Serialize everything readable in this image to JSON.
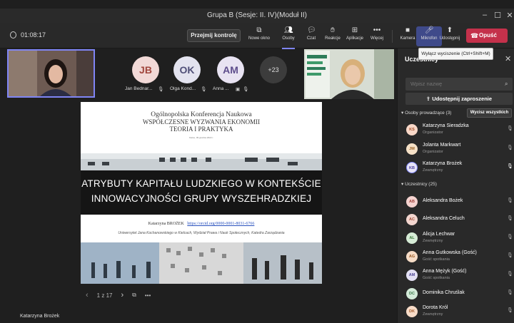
{
  "window": {
    "title": "Grupa B (Sesje: II. IV)(Moduł II)"
  },
  "toolbar": {
    "timer": "01:08:17",
    "take_control": "Przejmij kontrolę",
    "buttons": [
      {
        "label": "Nowe okno",
        "icon": "new-window-icon"
      },
      {
        "label": "Osoby",
        "icon": "people-icon"
      },
      {
        "label": "Czat",
        "icon": "chat-icon"
      },
      {
        "label": "Reakcje",
        "icon": "reactions-icon"
      },
      {
        "label": "Aplikacje",
        "icon": "apps-icon"
      },
      {
        "label": "Więcej",
        "icon": "more-icon"
      },
      {
        "label": "Kamera",
        "icon": "camera-icon"
      },
      {
        "label": "Mikrofon",
        "icon": "microphone-off-icon"
      },
      {
        "label": "Udostępnij",
        "icon": "share-icon"
      }
    ],
    "leave": "Opuść"
  },
  "tooltip": "Wyłącz wyciszenie (Ctrl+Shift+M)",
  "video_strip": {
    "participants": [
      {
        "initials": "JB",
        "name": "Jan Bednar...",
        "color": "#f2d9d7",
        "text_color": "#a1463d"
      },
      {
        "initials": "OK",
        "name": "Olga Kond...",
        "color": "#e3e3ef",
        "text_color": "#505078"
      },
      {
        "initials": "AM",
        "name": "Anna ...",
        "color": "#e8e3f2",
        "text_color": "#5e4e8c"
      }
    ],
    "overflow": "+23"
  },
  "slide": {
    "conf_line1": "Ogólnopolska Konferencja Naukowa",
    "conf_line2": "WSPÓŁCZESNE WYZWANIA EKONOMII",
    "conf_line3": "TEORIA I PRAKTYKA",
    "date": "Kielce, 09 grudnia 2022 r.",
    "title_line1": "ATRYBUTY KAPITAŁU LUDZKIEGO W KONTEKŚCIE",
    "title_line2": "INNOWACYJNOŚCI GRUPY WYSZEHRADZKIEJ",
    "author": "Katarzyna BROŻEK",
    "orcid": "https://orcid.org/0000-0001-8031-6766",
    "affiliation": "Uniwersytet Jana Kochanowskiego w Kielcach, Wydział Prawa i Nauk Społecznych, Katedra Zarządzania"
  },
  "pager": {
    "text": "1 z 17"
  },
  "presenter": "Katarzyna Brożek",
  "panel": {
    "title": "Uczestnicy",
    "search_placeholder": "Wpisz nazwę",
    "invite": "Udostępnij zaproszenie",
    "organizers_header": "Osoby prowadzące (3)",
    "mute_all": "Wycisz wszystkich",
    "organizers": [
      {
        "initials": "KS",
        "name": "Katarzyna Sieradzka",
        "role": "Organizator",
        "color": "#f9d8c8",
        "text_color": "#a3502a"
      },
      {
        "initials": "JM",
        "name": "Jolanta Markwart",
        "role": "Organizator",
        "color": "#f6e1c7",
        "text_color": "#9a6124"
      },
      {
        "initials": "KB",
        "name": "Katarzyna Brożek",
        "role": "Zewnętrzny",
        "color": "#e7e4f7",
        "text_color": "#4a3f9e"
      }
    ],
    "attendees_header": "Uczestnicy (25)",
    "attendees": [
      {
        "initials": "AB",
        "name": "Aleksandra Bożek",
        "role": "",
        "color": "#f5d3d0",
        "text_color": "#a0423b"
      },
      {
        "initials": "AC",
        "name": "Aleksandra Celuch",
        "role": "",
        "color": "#f3d6cf",
        "text_color": "#9f4a36"
      },
      {
        "initials": "AL",
        "name": "Alicja Lechwar",
        "role": "Zewnętrzny",
        "color": "#d6ecd6",
        "text_color": "#3c7a3c"
      },
      {
        "initials": "AG",
        "name": "Anna Gutkowska (Gość)",
        "role": "Gość spotkania",
        "color": "#f6dcc6",
        "text_color": "#9b5a24"
      },
      {
        "initials": "AM",
        "name": "Anna Mężyk (Gość)",
        "role": "Gość spotkania",
        "color": "#e3e0f4",
        "text_color": "#4d4594"
      },
      {
        "initials": "DC",
        "name": "Dominika Chruślak",
        "role": "",
        "color": "#d4ebd9",
        "text_color": "#3a7748"
      },
      {
        "initials": "DK",
        "name": "Dorota Król",
        "role": "Zewnętrzny",
        "color": "#f8dcc8",
        "text_color": "#a35a2a"
      }
    ]
  }
}
